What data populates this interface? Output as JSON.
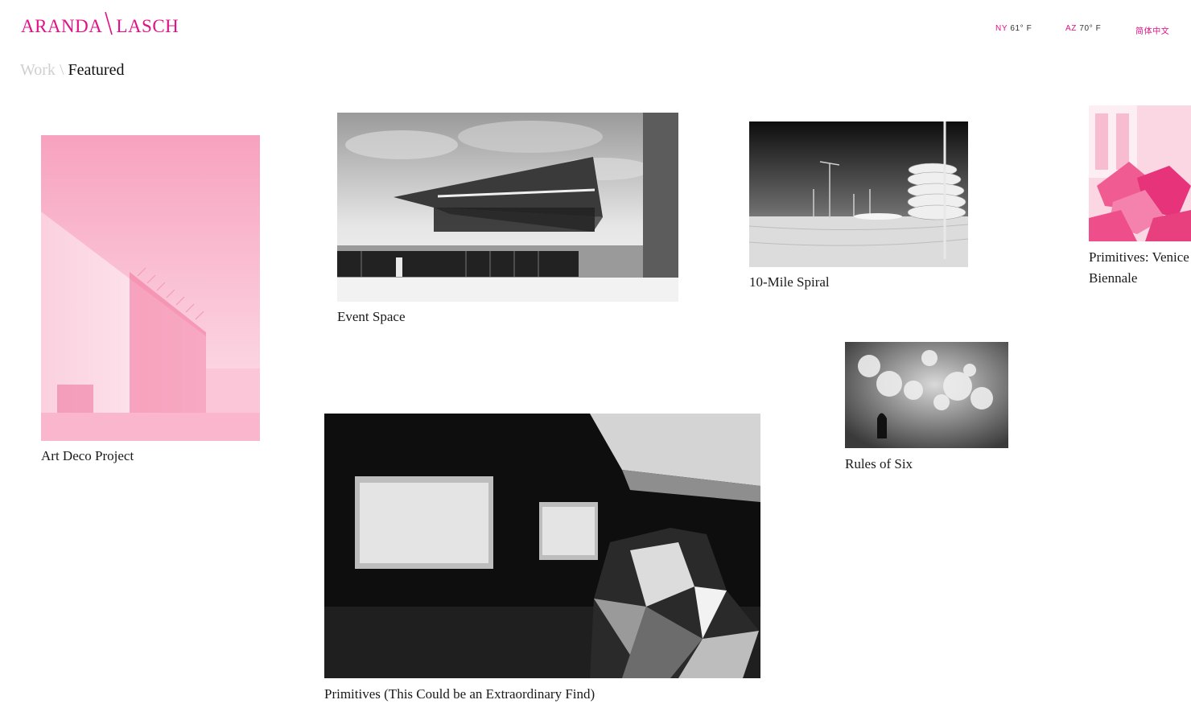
{
  "brand": {
    "name_left": "ARANDA",
    "name_right": "LASCH",
    "accent": "#e0128a"
  },
  "topnav": {
    "ny_city": "NY",
    "ny_temp": "61° F",
    "az_city": "AZ",
    "az_temp": "70° F",
    "language": "简体中文"
  },
  "breadcrumb": {
    "parent": "Work",
    "separator": "\\",
    "current": "Featured"
  },
  "projects": [
    {
      "title": "Art Deco Project",
      "tone": "pink"
    },
    {
      "title": "Event Space",
      "tone": "grayscale"
    },
    {
      "title": "10-Mile Spiral",
      "tone": "grayscale"
    },
    {
      "title": "Primitives: Venice",
      "title_line2": "Biennale",
      "tone": "pink"
    },
    {
      "title": "Rules of Six",
      "tone": "grayscale"
    },
    {
      "title": "Primitives (This Could be an Extraordinary Find)",
      "tone": "grayscale"
    }
  ]
}
